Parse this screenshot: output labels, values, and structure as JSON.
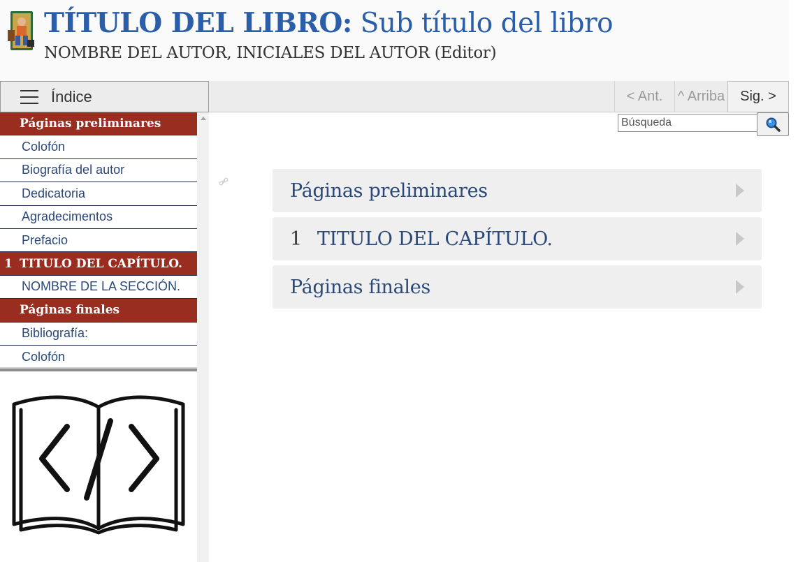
{
  "masthead": {
    "title": "TÍTULO DEL LIBRO:",
    "subtitle": "Sub título del libro",
    "byline": "NOMBRE DEL AUTOR, INICIALES DEL AUTOR (Editor)"
  },
  "toolbar": {
    "toc_label": "Índice",
    "prev_label": "< Ant.",
    "up_label": "^ Arriba",
    "next_label": "Sig. >"
  },
  "search": {
    "placeholder": "Búsqueda"
  },
  "sidebar": {
    "items": [
      {
        "kind": "part",
        "label": "Páginas preliminares"
      },
      {
        "kind": "sub",
        "label": "Colofón"
      },
      {
        "kind": "sub",
        "label": "Biografía del autor"
      },
      {
        "kind": "sub",
        "label": "Dedicatoria"
      },
      {
        "kind": "sub",
        "label": "Agradecimentos"
      },
      {
        "kind": "sub",
        "label": "Prefacio"
      },
      {
        "kind": "chapter",
        "number": "1",
        "label": "TITULO DEL CAPÍTULO."
      },
      {
        "kind": "sub",
        "label": "NOMBRE DE LA SECCIÓN."
      },
      {
        "kind": "part",
        "label": "Páginas finales"
      },
      {
        "kind": "sub",
        "label": "Bibliografía:"
      },
      {
        "kind": "sub",
        "label": "Colofón"
      }
    ]
  },
  "main": {
    "cards": [
      {
        "number": "",
        "label": "Páginas preliminares"
      },
      {
        "number": "1",
        "label": "TITULO DEL CAPÍTULO."
      },
      {
        "number": "",
        "label": "Páginas finales"
      }
    ]
  },
  "colors": {
    "title_blue": "#2a5ea8",
    "part_red": "#992d20",
    "link_blue": "#2a4878"
  },
  "icons": [
    "hamburger-menu-icon",
    "search-icon",
    "chevron-right-icon",
    "code-book-icon",
    "permalink-icon",
    "book-logo"
  ]
}
